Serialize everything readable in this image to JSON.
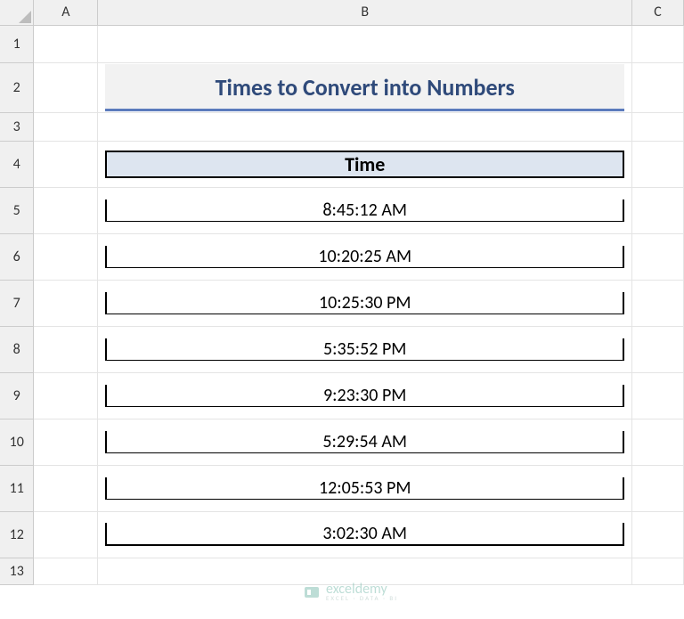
{
  "columns": [
    "A",
    "B",
    "C"
  ],
  "rows": [
    "1",
    "2",
    "3",
    "4",
    "5",
    "6",
    "7",
    "8",
    "9",
    "10",
    "11",
    "12",
    "13"
  ],
  "title": "Times to Convert into Numbers",
  "table_header": "Time",
  "times": [
    "8:45:12 AM",
    "10:20:25 AM",
    "10:25:30 PM",
    "5:35:52 PM",
    "9:23:30 PM",
    "5:29:54 AM",
    "12:05:53 PM",
    "3:02:30 AM"
  ],
  "watermark": {
    "brand": "exceldemy",
    "tagline": "EXCEL · DATA · BI"
  },
  "chart_data": {
    "type": "table",
    "title": "Times to Convert into Numbers",
    "columns": [
      "Time"
    ],
    "rows": [
      [
        "8:45:12 AM"
      ],
      [
        "10:20:25 AM"
      ],
      [
        "10:25:30 PM"
      ],
      [
        "5:35:52 PM"
      ],
      [
        "9:23:30 PM"
      ],
      [
        "5:29:54 AM"
      ],
      [
        "12:05:53 PM"
      ],
      [
        "3:02:30 AM"
      ]
    ]
  }
}
